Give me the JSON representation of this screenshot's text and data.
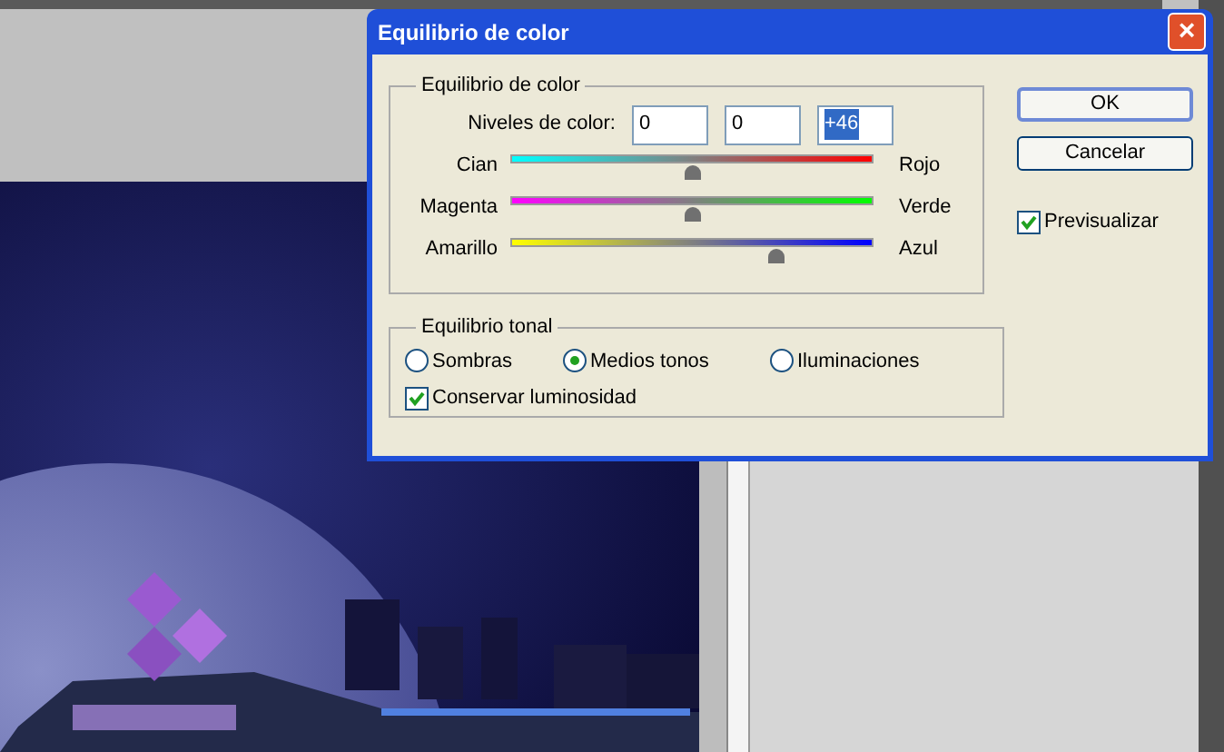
{
  "dialog": {
    "title": "Equilibrio de color",
    "close_button": "×",
    "color_balance": {
      "legend": "Equilibrio de color",
      "levels_label": "Niveles de color:",
      "fields": [
        {
          "value": "0",
          "text_selected": false
        },
        {
          "value": "0",
          "text_selected": false
        },
        {
          "value": "+46",
          "text_selected": true
        }
      ],
      "sliders": [
        {
          "left": "Cian",
          "right": "Rojo",
          "level": 0.5
        },
        {
          "left": "Magenta",
          "right": "Verde",
          "level": 0.5
        },
        {
          "left": "Amarillo",
          "right": "Azul",
          "level": 0.73
        }
      ]
    },
    "tonal_balance": {
      "legend": "Equilibrio tonal",
      "radios": [
        {
          "label": "Sombras",
          "selected": false
        },
        {
          "label": "Medios tonos",
          "selected": true
        },
        {
          "label": "Iluminaciones",
          "selected": false
        }
      ],
      "preserve_luminosity": {
        "label": "Conservar luminosidad",
        "checked": true
      }
    },
    "buttons": [
      {
        "label": "OK",
        "default": true
      },
      {
        "label": "Cancelar",
        "default": false
      }
    ],
    "preview": {
      "label": "Previsualizar",
      "checked": true
    }
  }
}
